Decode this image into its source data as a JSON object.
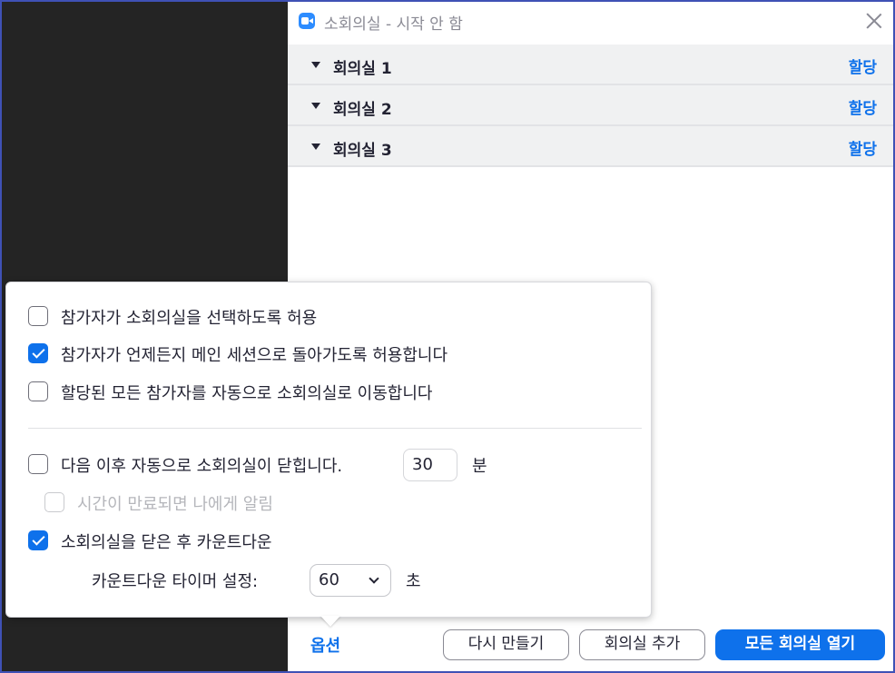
{
  "window": {
    "title": "소회의실 - 시작 안 함"
  },
  "rooms": [
    {
      "name": "회의실 1",
      "assign_label": "할당"
    },
    {
      "name": "회의실 2",
      "assign_label": "할당"
    },
    {
      "name": "회의실 3",
      "assign_label": "할당"
    }
  ],
  "options_popover": {
    "allow_choose_room": {
      "label": "참가자가 소회의실을 선택하도록 허용",
      "checked": false
    },
    "allow_return_main": {
      "label": "참가자가 언제든지 메인 세션으로 돌아가도록 허용합니다",
      "checked": true
    },
    "auto_move": {
      "label": "할당된 모든 참가자를 자동으로 소회의실로 이동합니다",
      "checked": false
    },
    "auto_close": {
      "label": "다음 이후 자동으로 소회의실이 닫힙니다.",
      "value": "30",
      "unit": "분",
      "checked": false
    },
    "notify_expire": {
      "label": "시간이 만료되면 나에게 알림",
      "checked": false,
      "disabled": true
    },
    "countdown": {
      "label": "소회의실을 닫은 후 카운트다운",
      "checked": true
    },
    "countdown_timer": {
      "label": "카운트다운 타이머 설정:",
      "value": "60",
      "unit": "초"
    }
  },
  "footer": {
    "options_label": "옵션",
    "recreate_label": "다시 만들기",
    "add_room_label": "회의실 추가",
    "open_all_label": "모든 회의실 열기"
  },
  "colors": {
    "accent": "#0e71eb",
    "dark_background": "#242424",
    "room_row": "#f0f1f2"
  }
}
